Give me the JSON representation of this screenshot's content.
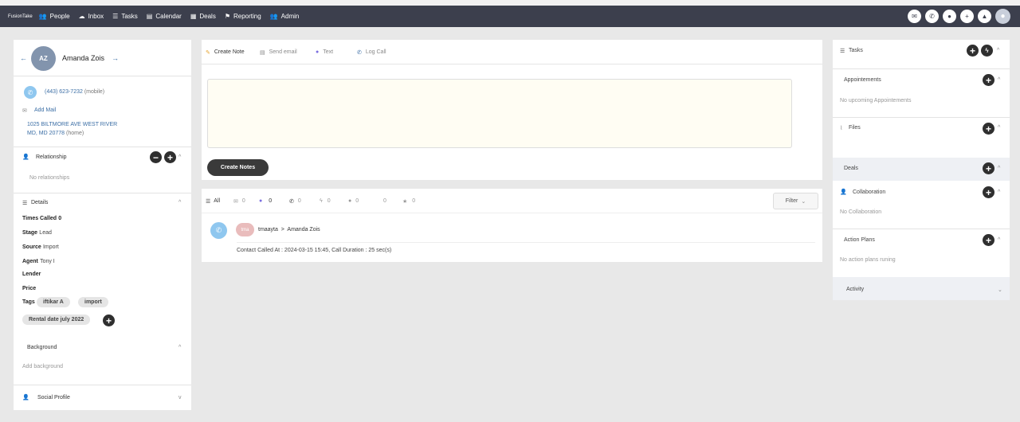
{
  "nav": {
    "logo": "FusionTake",
    "items": [
      {
        "icon": "people-icon",
        "glyph": "👥",
        "label": "People"
      },
      {
        "icon": "inbox-icon",
        "glyph": "☁",
        "label": "Inbox"
      },
      {
        "icon": "tasks-icon",
        "glyph": "☰",
        "label": "Tasks"
      },
      {
        "icon": "calendar-icon",
        "glyph": "▤",
        "label": "Calendar"
      },
      {
        "icon": "deals-icon",
        "glyph": "▦",
        "label": "Deals"
      },
      {
        "icon": "reporting-icon",
        "glyph": "⚑",
        "label": "Reporting"
      },
      {
        "icon": "admin-icon",
        "glyph": "👥",
        "label": "Admin"
      }
    ],
    "right_icons": [
      "mail-icon",
      "phone-icon",
      "chat-icon",
      "add-user-icon",
      "bell-icon",
      "user-avatar-icon"
    ],
    "bg": "#3c3f4d"
  },
  "contact": {
    "initials": "AZ",
    "name": "Amanda Zois",
    "phone": "(443) 623-7232",
    "phone_type": "(mobile)",
    "add_mail": "Add Mail",
    "address_line1": "1025 BILTMORE AVE WEST RIVER",
    "address_line2": "MD, MD 20778",
    "address_type": "(home)",
    "avatar_color": "#8294ad"
  },
  "relationship": {
    "title": "Relationship",
    "empty": "No relationships"
  },
  "details": {
    "title": "Details",
    "times_called_label": "Times Called",
    "times_called_value": "0",
    "stage_label": "Stage",
    "stage_value": "Lead",
    "source_label": "Source",
    "source_value": "Import",
    "agent_label": "Agent",
    "agent_value": "Tony I",
    "lender_label": "Lender",
    "price_label": "Price",
    "tags_label": "Tags",
    "tags": [
      "iftikar A",
      "import",
      "Rental date july 2022"
    ]
  },
  "background": {
    "title": "Background",
    "placeholder": "Add background"
  },
  "social": {
    "title": "Social Profile"
  },
  "composer": {
    "tabs": [
      {
        "icon": "pencil-icon",
        "label": "Create Note"
      },
      {
        "icon": "email-icon",
        "label": "Send email"
      },
      {
        "icon": "text-icon",
        "label": "Text"
      },
      {
        "icon": "phone-icon",
        "label": "Log Call"
      }
    ],
    "create_label": "Create Notes"
  },
  "timeline": {
    "all_label": "All",
    "counts": [
      "0",
      "0",
      "0",
      "0",
      "0",
      "0",
      "0"
    ],
    "filter_label": "Filter",
    "entry": {
      "badge": "tma",
      "from": "tmaayta",
      "arrow": ">",
      "to": "Amanda Zois",
      "detail": "Contact Called At : 2024-03-15 15:45, Call Duration : 25 sec(s)"
    }
  },
  "sidebar_right": {
    "tasks": "Tasks",
    "appointments": "Appointements",
    "appointments_empty": "No upcoming Appointements",
    "files": "Files",
    "deals": "Deals",
    "collaboration": "Collaboration",
    "collaboration_empty": "No Collaboration",
    "action_plans": "Action Plans",
    "action_plans_empty": "No action plans runing",
    "activity": "Activity"
  }
}
